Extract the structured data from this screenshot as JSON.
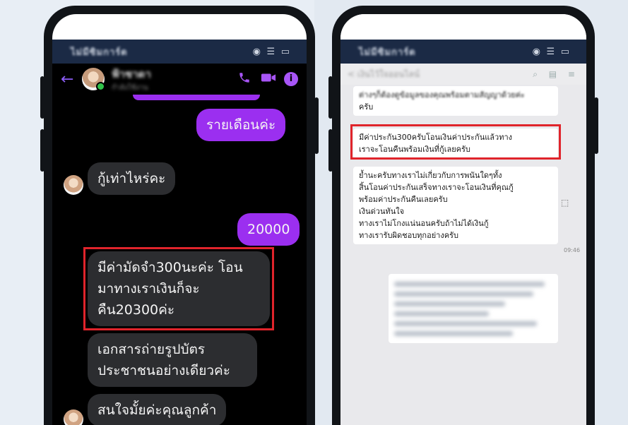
{
  "left_phone": {
    "status": {
      "carrier": "ไม่มีซิมการ์ด",
      "icons": "◉ ☰ ▭"
    },
    "header": {
      "contact_name": "ฟ้าชาดา",
      "contact_status": "กำลังใช้งาน",
      "back_icon": "arrow-left-icon",
      "call_icon": "phone-icon",
      "video_icon": "video-icon",
      "info_icon": "info-icon"
    },
    "messages": [
      {
        "side": "out",
        "text": "รายเดือนค่ะ"
      },
      {
        "side": "in",
        "text": "กู้เท่าไหร่คะ"
      },
      {
        "side": "out",
        "text": "20000"
      },
      {
        "side": "in",
        "lines": [
          "มีค่ามัดจำ300นะค่ะ โอน",
          "มาทางเราเงินก็จะ",
          "คืน20300ค่ะ"
        ],
        "highlighted": true
      },
      {
        "side": "in",
        "lines": [
          "เอกสารถ่ายรูปบัตร",
          "ประชาชนอย่างเดียวค่ะ"
        ]
      },
      {
        "side": "in",
        "text": "สนใจมั้ยค่ะคุณลูกค้า"
      }
    ]
  },
  "right_phone": {
    "status": {
      "carrier": "ไม่มีซิมการ์ด",
      "icons": "◉ ☰ ▭"
    },
    "header": {
      "title": "< เงินไว้ใจออนไลน์",
      "icons": "⌕ ▤ ≡"
    },
    "messages": [
      {
        "lines": [
          "ต่างๆก็ต้องดูข้อมูลของคุณพร้อมตามสัญญาด้วยค่ะ",
          "ครับ"
        ]
      },
      {
        "lines": [
          "มีค่าประกัน300ครับโอนเงินค่าประกันแล้วทาง",
          "เราจะโอนคืนพร้อมเงินที่กู้เลยครับ"
        ],
        "highlighted": true
      },
      {
        "lines": [
          "ย้ำนะครับทางเราไม่เกี่ยวกับการพนันใดๆทั้ง",
          "สิ้นโอนค่าประกันเสร็จทางเราจะโอนเงินที่คุณกู้",
          "พร้อมค่าประกันคืนเลยครับ",
          "เงินด่วนทันใจ",
          "ทางเราไม่โกงแน่นอนครับถ้าไม่ได้เงินกู้",
          "ทางเรารับผิดชอบทุกอย่างครับ"
        ]
      }
    ],
    "time": "09:46"
  },
  "colors": {
    "highlight": "#e0242b",
    "messenger_purple": "#9b2ff0",
    "incoming_gray": "#2c2d30"
  }
}
